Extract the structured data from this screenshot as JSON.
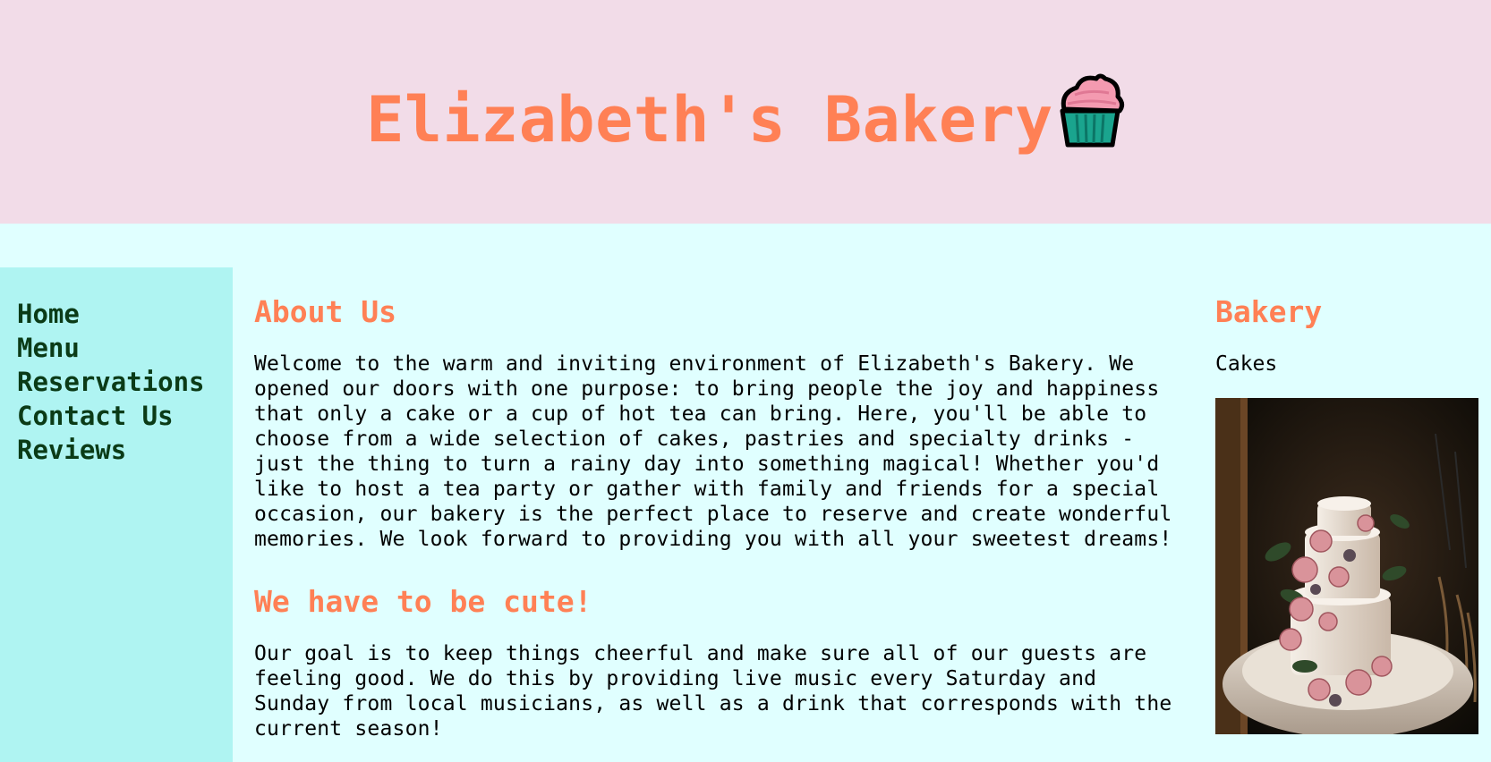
{
  "header": {
    "title": "Elizabeth's Bakery",
    "logo_icon": "cupcake-icon"
  },
  "nav": {
    "items": [
      "Home",
      "Menu",
      "Reservations",
      "Contact Us",
      "Reviews"
    ]
  },
  "main": {
    "about_heading": "About Us",
    "about_text": "Welcome to the warm and inviting environment of Elizabeth's Bakery. We opened our doors with one purpose: to bring people the joy and happiness that only a cake or a cup of hot tea can bring. Here, you'll be able to choose from a wide selection of cakes, pastries and specialty drinks - just the thing to turn a rainy day into something magical! Whether you'd like to host a tea party or gather with family and friends for a special occasion, our bakery is the perfect place to reserve and create wonderful memories. We look forward to providing you with all your sweetest dreams!",
    "cute_heading": "We have to be cute!",
    "cute_text": "Our goal is to keep things cheerful and make sure all of our guests are feeling good. We do this by providing live music every Saturday and Sunday from local musicians, as well as a drink that corresponds with the current season!"
  },
  "aside": {
    "heading": "Bakery",
    "caption": "Cakes",
    "image_subject": "three-tier white wedding cake with pink roses"
  },
  "colors": {
    "header_bg": "#f2dce8",
    "page_bg": "#e0ffff",
    "sidebar_bg": "#aff4f2",
    "accent": "#ff8055",
    "nav_text": "#0b3b17"
  }
}
